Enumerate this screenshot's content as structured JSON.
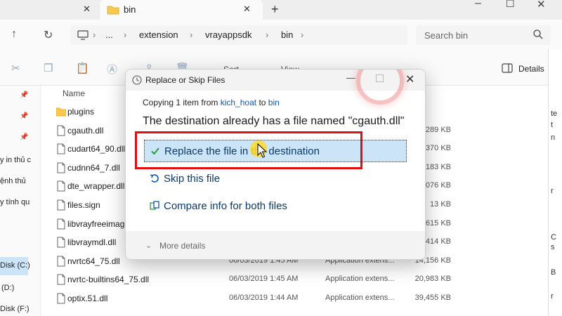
{
  "tabs": [
    {
      "label": ""
    },
    {
      "label": "bin"
    }
  ],
  "address": {
    "crumbs": [
      "...",
      "extension",
      "vrayappsdk",
      "bin"
    ],
    "search_placeholder": "Search bin"
  },
  "toolbar": {
    "sort_label": "Sort",
    "view_label": "View",
    "more_label": "...",
    "details_label": "Details"
  },
  "navpane": {
    "items": [
      "y in thủ c",
      "ệnh thủ",
      "y tính qu",
      "Disk (C:)",
      "(D:)",
      "Disk (F:)"
    ]
  },
  "filelist": {
    "column_name": "Name",
    "rows": [
      {
        "name": "plugins",
        "date": "",
        "type": "",
        "size": "",
        "icon": "folder-icon"
      },
      {
        "name": "cgauth.dll",
        "date": "",
        "type": "",
        "size": "289 KB",
        "icon": "file-icon"
      },
      {
        "name": "cudart64_90.dll",
        "date": "",
        "type": "",
        "size": "370 KB",
        "icon": "file-icon"
      },
      {
        "name": "cudnn64_7.dll",
        "date": "",
        "type": "",
        "size": "183 KB",
        "icon": "file-icon"
      },
      {
        "name": "dte_wrapper.dll",
        "date": "",
        "type": "",
        "size": "076 KB",
        "icon": "file-icon"
      },
      {
        "name": "files.sign",
        "date": "",
        "type": "",
        "size": "13 KB",
        "icon": "file-icon"
      },
      {
        "name": "libvrayfreeimage",
        "date": "",
        "type": "",
        "size": "615 KB",
        "icon": "file-icon"
      },
      {
        "name": "libvraymdl.dll",
        "date": "",
        "type": "",
        "size": "414 KB",
        "icon": "file-icon"
      },
      {
        "name": "nvrtc64_75.dll",
        "date": "06/03/2019 1:45 AM",
        "type": "Application extens...",
        "size": "14,156 KB",
        "icon": "file-icon"
      },
      {
        "name": "nvrtc-builtins64_75.dll",
        "date": "06/03/2019 1:45 AM",
        "type": "Application extens...",
        "size": "20,983 KB",
        "icon": "file-icon"
      },
      {
        "name": "optix.51.dll",
        "date": "06/03/2019 1:44 AM",
        "type": "Application extens...",
        "size": "39,455 KB",
        "icon": "file-icon"
      }
    ]
  },
  "right_edge": {
    "chars": [
      "te",
      "t",
      "n",
      "r",
      "C",
      "s",
      "B",
      "r"
    ]
  },
  "dialog": {
    "title": "Replace or Skip Files",
    "copying_prefix": "Copying 1 item from",
    "from_link": "kich_hoat",
    "to_word": "to",
    "to_link": "bin",
    "destination_message": "The destination already has a file named \"cgauth.dll\"",
    "options": [
      {
        "label": "Replace the file in the destination",
        "icon": "check-icon"
      },
      {
        "label": "Skip this file",
        "icon": "skip-icon"
      },
      {
        "label": "Compare info for both files",
        "icon": "compare-icon"
      }
    ],
    "more_details": "More details"
  },
  "colors": {
    "accent": "#0a58b8",
    "selection": "#cce4f7",
    "highlight_box": "#e01010",
    "check_green": "#2e9b3a"
  }
}
